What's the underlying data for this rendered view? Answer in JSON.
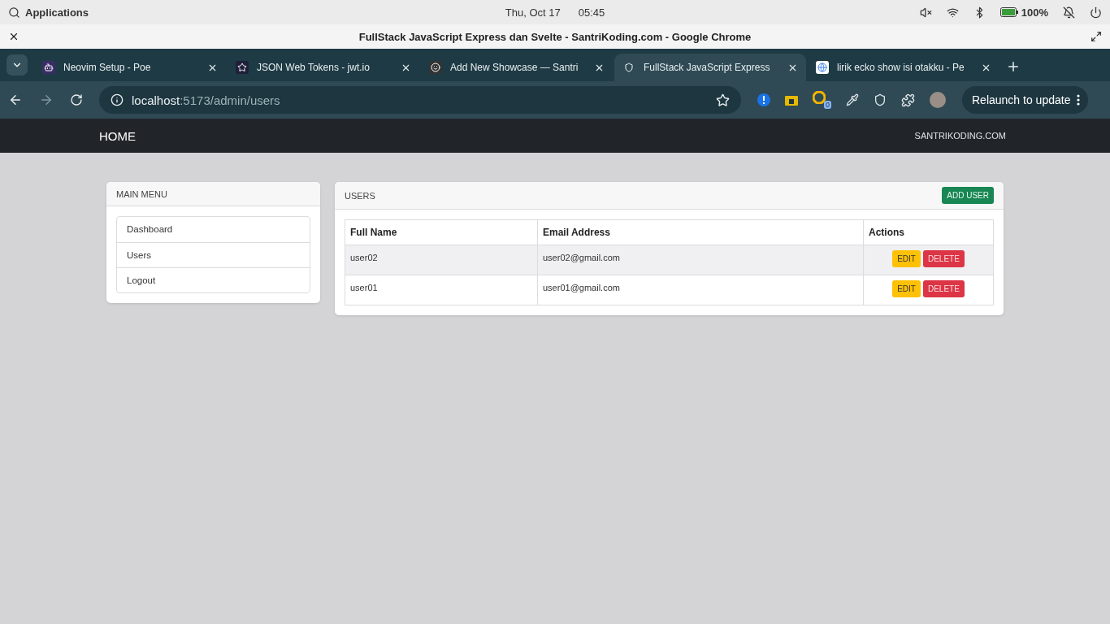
{
  "system_bar": {
    "launcher": "Applications",
    "date": "Thu, Oct 17",
    "time": "05:45",
    "battery": "100%"
  },
  "window": {
    "title": "FullStack JavaScript Express dan Svelte - SantriKoding.com - Google Chrome"
  },
  "tabs": [
    {
      "title": "Neovim Setup - Poe",
      "selected": false
    },
    {
      "title": "JSON Web Tokens - jwt.io",
      "selected": false
    },
    {
      "title": "Add New Showcase — Santri",
      "selected": false
    },
    {
      "title": "FullStack JavaScript Express",
      "selected": true
    },
    {
      "title": "lirik ecko show isi otakku - Pe",
      "selected": false
    }
  ],
  "toolbar": {
    "forward_disabled": true,
    "url_host": "localhost",
    "url_path": ":5173/admin/users",
    "extension_badge": "0",
    "relaunch": "Relaunch to update"
  },
  "navbar": {
    "brand": "HOME",
    "right": "SANTRIKODING.COM"
  },
  "menu": {
    "title": "MAIN MENU",
    "items": [
      "Dashboard",
      "Users",
      "Logout"
    ]
  },
  "users": {
    "title": "USERS",
    "add_button": "ADD USER",
    "columns": [
      "Full Name",
      "Email Address",
      "Actions"
    ],
    "rows": [
      {
        "name": "user02",
        "email": "user02@gmail.com",
        "edit": "EDIT",
        "delete": "DELETE"
      },
      {
        "name": "user01",
        "email": "user01@gmail.com",
        "edit": "EDIT",
        "delete": "DELETE"
      }
    ]
  }
}
